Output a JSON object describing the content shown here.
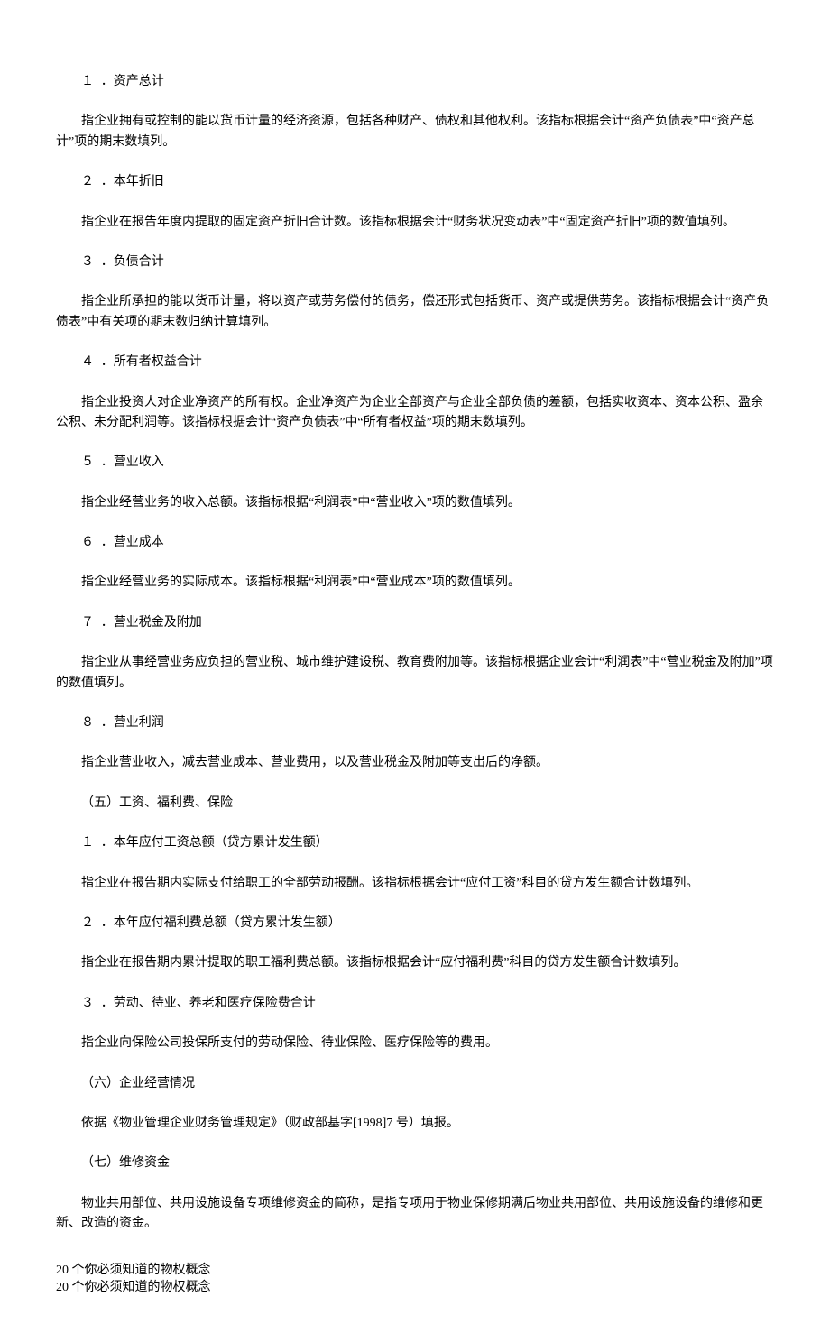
{
  "sections": {
    "s1": {
      "heading": "１ ．资产总计",
      "body": "指企业拥有或控制的能以货币计量的经济资源，包括各种财产、债权和其他权利。该指标根据会计“资产负债表”中“资产总计”项的期末数填列。"
    },
    "s2": {
      "heading": "２ ．本年折旧",
      "body": "指企业在报告年度内提取的固定资产折旧合计数。该指标根据会计“财务状况变动表”中“固定资产折旧”项的数值填列。"
    },
    "s3": {
      "heading": "３ ．负债合计",
      "body": "指企业所承担的能以货币计量，将以资产或劳务偿付的债务，偿还形式包括货币、资产或提供劳务。该指标根据会计“资产负债表”中有关项的期末数归纳计算填列。"
    },
    "s4": {
      "heading": "４ ．所有者权益合计",
      "body": "指企业投资人对企业净资产的所有权。企业净资产为企业全部资产与企业全部负债的差额，包括实收资本、资本公积、盈余公积、未分配利润等。该指标根据会计“资产负债表”中“所有者权益”项的期末数填列。"
    },
    "s5": {
      "heading": "５ ．营业收入",
      "body": "指企业经营业务的收入总额。该指标根据“利润表”中“营业收入”项的数值填列。"
    },
    "s6": {
      "heading": "６ ．营业成本",
      "body": "指企业经营业务的实际成本。该指标根据“利润表”中“营业成本”项的数值填列。"
    },
    "s7": {
      "heading": "７ ．营业税金及附加",
      "body": "指企业从事经营业务应负担的营业税、城市维护建设税、教育费附加等。该指标根据企业会计“利润表”中“营业税金及附加”项的数值填列。"
    },
    "s8": {
      "heading": "８ ．营业利润",
      "body": "指企业营业收入，减去营业成本、营业费用，以及营业税金及附加等支出后的净额。"
    },
    "s9": {
      "heading": "（五）工资、福利费、保险"
    },
    "s10": {
      "heading": "１ ．本年应付工资总额（贷方累计发生额）",
      "body": "指企业在报告期内实际支付给职工的全部劳动报酬。该指标根据会计“应付工资”科目的贷方发生额合计数填列。"
    },
    "s11": {
      "heading": "２ ．本年应付福利费总额（贷方累计发生额）",
      "body": "指企业在报告期内累计提取的职工福利费总额。该指标根据会计“应付福利费”科目的贷方发生额合计数填列。"
    },
    "s12": {
      "heading": "３ ．劳动、待业、养老和医疗保险费合计",
      "body": "指企业向保险公司投保所支付的劳动保险、待业保险、医疗保险等的费用。"
    },
    "s13": {
      "heading": "（六）企业经营情况",
      "body": "依据《物业管理企业财务管理规定》（财政部基字[1998]7 号）填报。"
    },
    "s14": {
      "heading": "（七）维修资金",
      "body": "物业共用部位、共用设施设备专项维修资金的简称，是指专项用于物业保修期满后物业共用部位、共用设施设备的维修和更新、改造的资金。"
    }
  },
  "footer": {
    "line1": "20 个你必须知道的物权概念",
    "line2": "20 个你必须知道的物权概念"
  }
}
